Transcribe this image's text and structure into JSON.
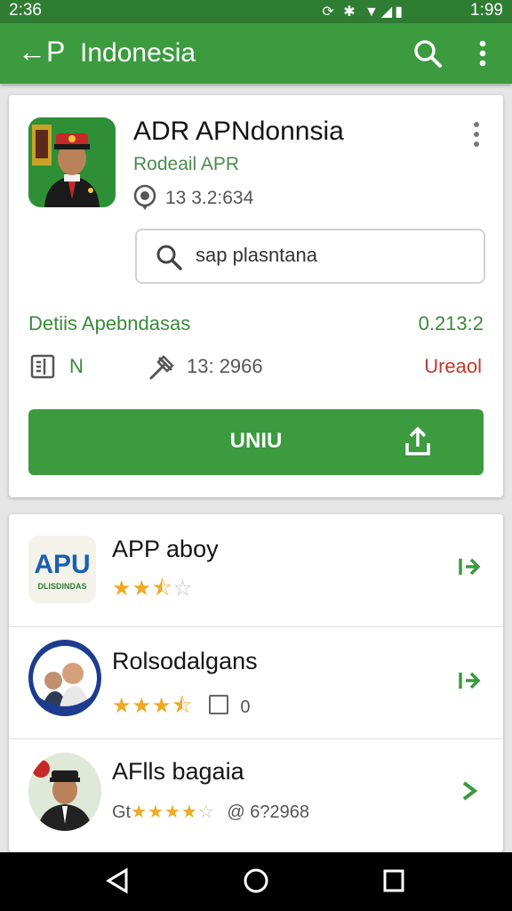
{
  "status": {
    "time_left": "2:36",
    "time_right": "1:99"
  },
  "appbar": {
    "back_label": "←P",
    "title": "Indonesia"
  },
  "app": {
    "name": "ADR APNdonnsia",
    "developer": "Rodeail APR",
    "reviews": "13 3.2:634",
    "search_text": "sap plasntana",
    "details_label": "Detiis Apebndasas",
    "details_value": "0.213:2",
    "n_label": "N",
    "downloads": "13: 2966",
    "status_red": "Ureaol",
    "install_label": "UNIU"
  },
  "list": {
    "items": [
      {
        "name": "APP aboy",
        "rating": 3,
        "meta": "",
        "logo_text": "APU",
        "logo_sub": "DLISDINDAS"
      },
      {
        "name": "Rolsodalgans",
        "rating": 3.5,
        "meta": "0"
      },
      {
        "name": "AFlls bagaia",
        "rating": 4,
        "meta": "@ 6?2968",
        "prefix": "Gt"
      }
    ]
  },
  "colors": {
    "primary": "#3c9a3f",
    "status_bar": "#2e7d32",
    "star": "#f0a825",
    "alert": "#c0392b"
  }
}
